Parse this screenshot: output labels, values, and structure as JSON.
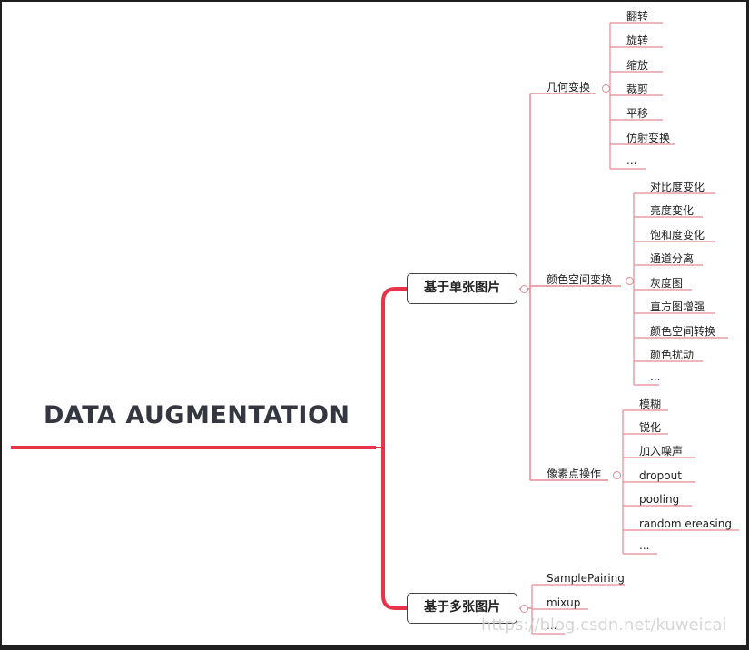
{
  "root": {
    "label": "DATA AUGMENTATION"
  },
  "single": {
    "label": "基于单张图片",
    "geometric": {
      "label": "几何变换",
      "items": [
        "翻转",
        "旋转",
        "缩放",
        "裁剪",
        "平移",
        "仿射变换",
        "..."
      ]
    },
    "color": {
      "label": "颜色空间变换",
      "items": [
        "对比度变化",
        "亮度变化",
        "饱和度变化",
        "通道分离",
        "灰度图",
        "直方图增强",
        "颜色空间转换",
        "颜色扰动",
        "..."
      ]
    },
    "pixel": {
      "label": "像素点操作",
      "items": [
        "模糊",
        "锐化",
        "加入噪声",
        "dropout",
        "pooling",
        "random ereasing",
        "..."
      ]
    }
  },
  "multi": {
    "label": "基于多张图片",
    "items": [
      "SamplePairing",
      "mixup",
      "..."
    ]
  },
  "watermark": "https://blog.csdn.net/kuweicai",
  "colors": {
    "accent": "#e8334a",
    "branch": "#e48a95"
  }
}
